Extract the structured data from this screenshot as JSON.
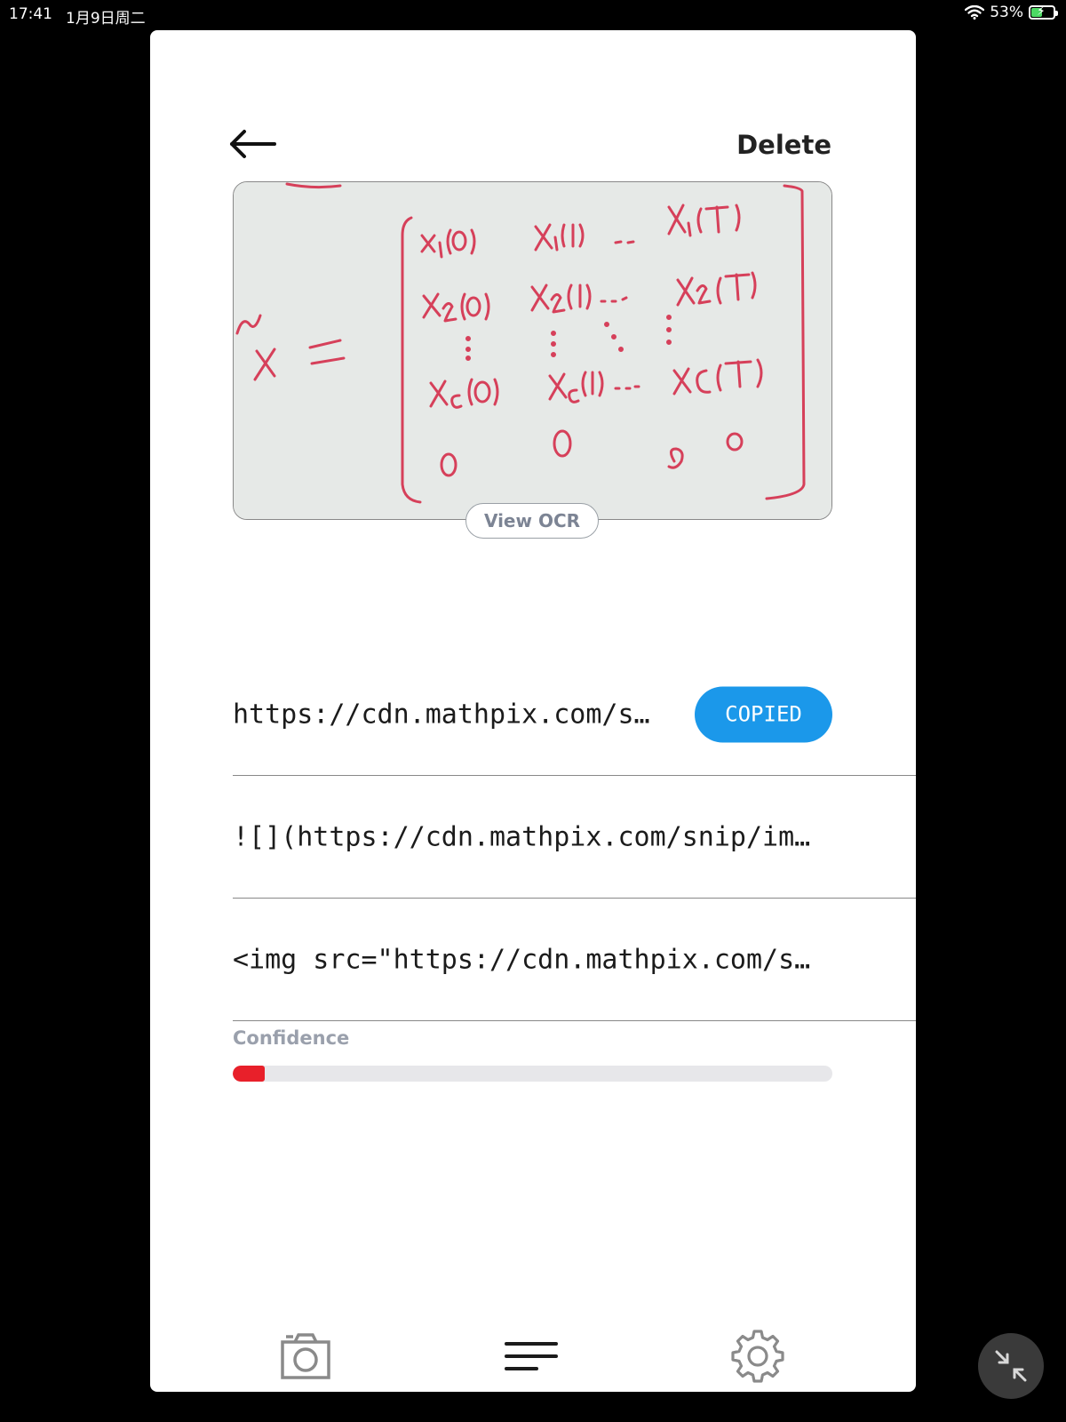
{
  "status_bar": {
    "time": "17:41",
    "date": "1月9日周二",
    "battery_percent_label": "53%",
    "battery_level": 0.53
  },
  "header": {
    "back_icon": "arrow-left-icon",
    "delete_label": "Delete"
  },
  "snip": {
    "view_ocr_label": "View OCR"
  },
  "formats": [
    {
      "text": "https://cdn.mathpix.com/snip/images/…",
      "button_label": "COPIED"
    },
    {
      "text": "![](https://cdn.mathpix.com/snip/images/…"
    },
    {
      "text": "<img src=\"https://cdn.mathpix.com/snip/images/…"
    }
  ],
  "confidence": {
    "label": "Confidence",
    "value": 0.053,
    "color": "#e8202a"
  },
  "tabbar": {
    "items": [
      "camera-icon",
      "list-icon",
      "gear-icon"
    ]
  },
  "colors": {
    "accent": "#1b98ea",
    "ink": "#d6405a"
  }
}
